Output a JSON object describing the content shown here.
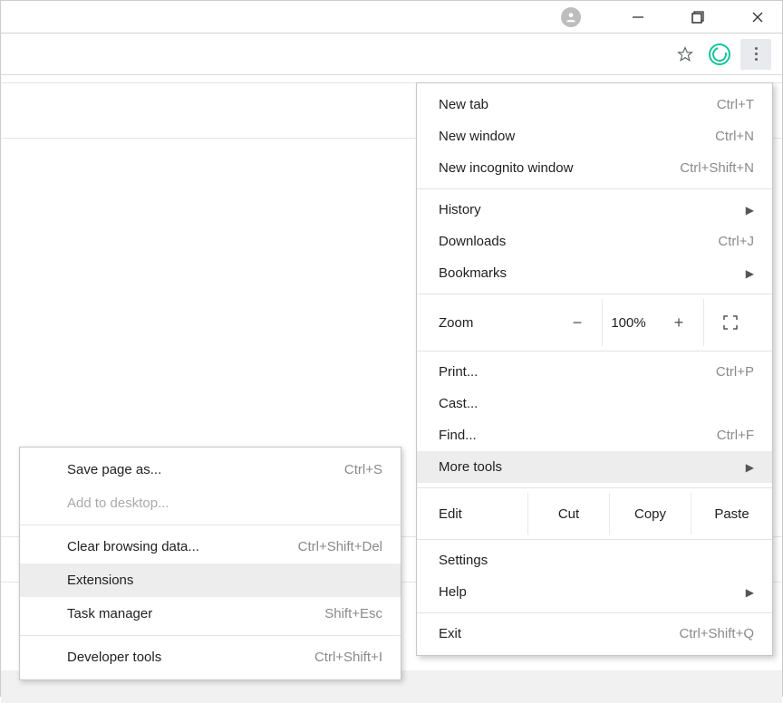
{
  "menu": {
    "new_tab": {
      "label": "New tab",
      "shortcut": "Ctrl+T"
    },
    "new_window": {
      "label": "New window",
      "shortcut": "Ctrl+N"
    },
    "new_incognito": {
      "label": "New incognito window",
      "shortcut": "Ctrl+Shift+N"
    },
    "history": {
      "label": "History"
    },
    "downloads": {
      "label": "Downloads",
      "shortcut": "Ctrl+J"
    },
    "bookmarks": {
      "label": "Bookmarks"
    },
    "zoom": {
      "label": "Zoom",
      "minus": "−",
      "value": "100%",
      "plus": "+"
    },
    "print": {
      "label": "Print...",
      "shortcut": "Ctrl+P"
    },
    "cast": {
      "label": "Cast..."
    },
    "find": {
      "label": "Find...",
      "shortcut": "Ctrl+F"
    },
    "more_tools": {
      "label": "More tools"
    },
    "edit": {
      "label": "Edit",
      "cut": "Cut",
      "copy": "Copy",
      "paste": "Paste"
    },
    "settings": {
      "label": "Settings"
    },
    "help": {
      "label": "Help"
    },
    "exit": {
      "label": "Exit",
      "shortcut": "Ctrl+Shift+Q"
    }
  },
  "submenu": {
    "save_page": {
      "label": "Save page as...",
      "shortcut": "Ctrl+S"
    },
    "add_desktop": {
      "label": "Add to desktop..."
    },
    "clear_browsing": {
      "label": "Clear browsing data...",
      "shortcut": "Ctrl+Shift+Del"
    },
    "extensions": {
      "label": "Extensions"
    },
    "task_manager": {
      "label": "Task manager",
      "shortcut": "Shift+Esc"
    },
    "dev_tools": {
      "label": "Developer tools",
      "shortcut": "Ctrl+Shift+I"
    }
  }
}
